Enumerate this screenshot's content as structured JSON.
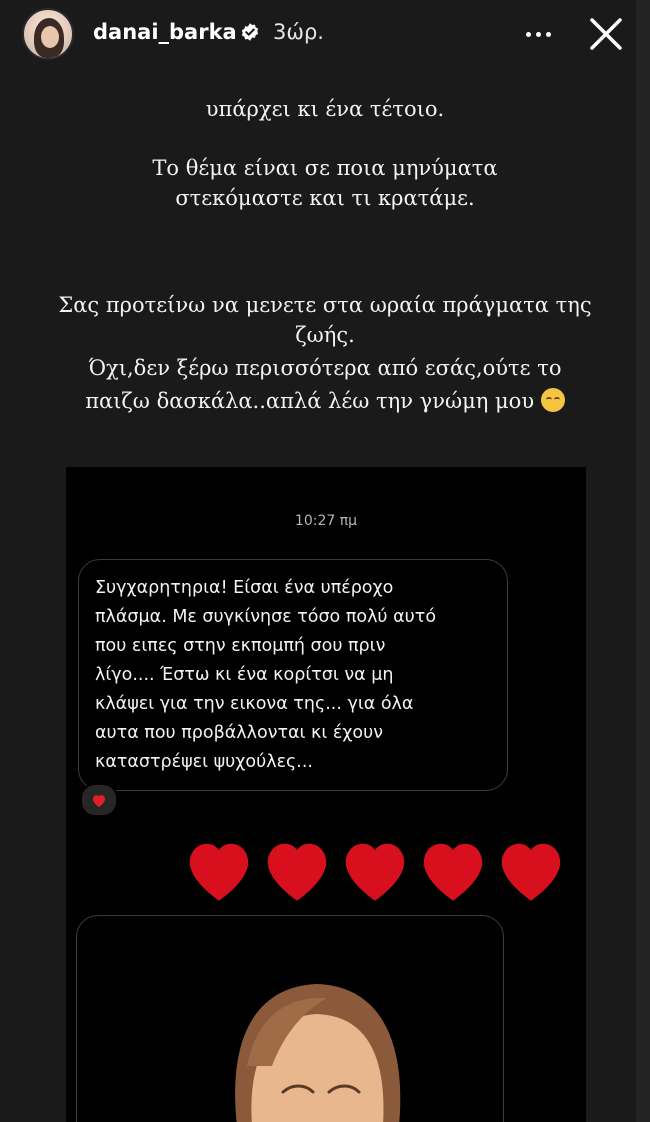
{
  "header": {
    "username": "danai_barka",
    "time_ago": "3ώρ.",
    "avatar_icon": "profile-avatar",
    "verified_icon": "verified-badge-icon",
    "more_icon": "more-horizontal-icon",
    "close_icon": "close-icon"
  },
  "story_text": {
    "line1": "υπάρχει κι ένα τέτοιο.",
    "line2": "Το θέμα είναι σε ποια μηνύματα",
    "line3": "στεκόμαστε και τι κρατάμε.",
    "line4": "Σας προτείνω να μενετε στα ωραία πράγματα της",
    "line5": "ζωής.",
    "line6": "Όχι,δεν ξέρω περισσότερα από εσάς,ούτε το",
    "line7": "παιζω δασκάλα..απλά λέω την γνώμη μου",
    "emoji": "relieved-face-emoji"
  },
  "chat": {
    "time": "10:27 πμ",
    "message_lines": [
      "Συγχαρητηρια! Είσαι ένα υπέροχο",
      "πλάσμα. Με συγκίνησε τόσο πολύ αυτό",
      "που ειπες στην εκπομπή σου πριν",
      "λίγο.... Έστω κι ένα κορίτσι να μη",
      "κλάψει για την εικονα της... για όλα",
      "αυτα που προβάλλονται κι έχουν",
      "καταστρέψει ψυχούλες..."
    ],
    "reaction_icon": "heart-reaction-icon",
    "hearts_count": 5,
    "heart_color": "#d8101d",
    "memoji": "memoji-sticker"
  },
  "colors": {
    "background": "#1a1a1a",
    "chat_background": "#000000",
    "bubble_border": "#3b3b3b",
    "text": "#f2f2f2"
  }
}
